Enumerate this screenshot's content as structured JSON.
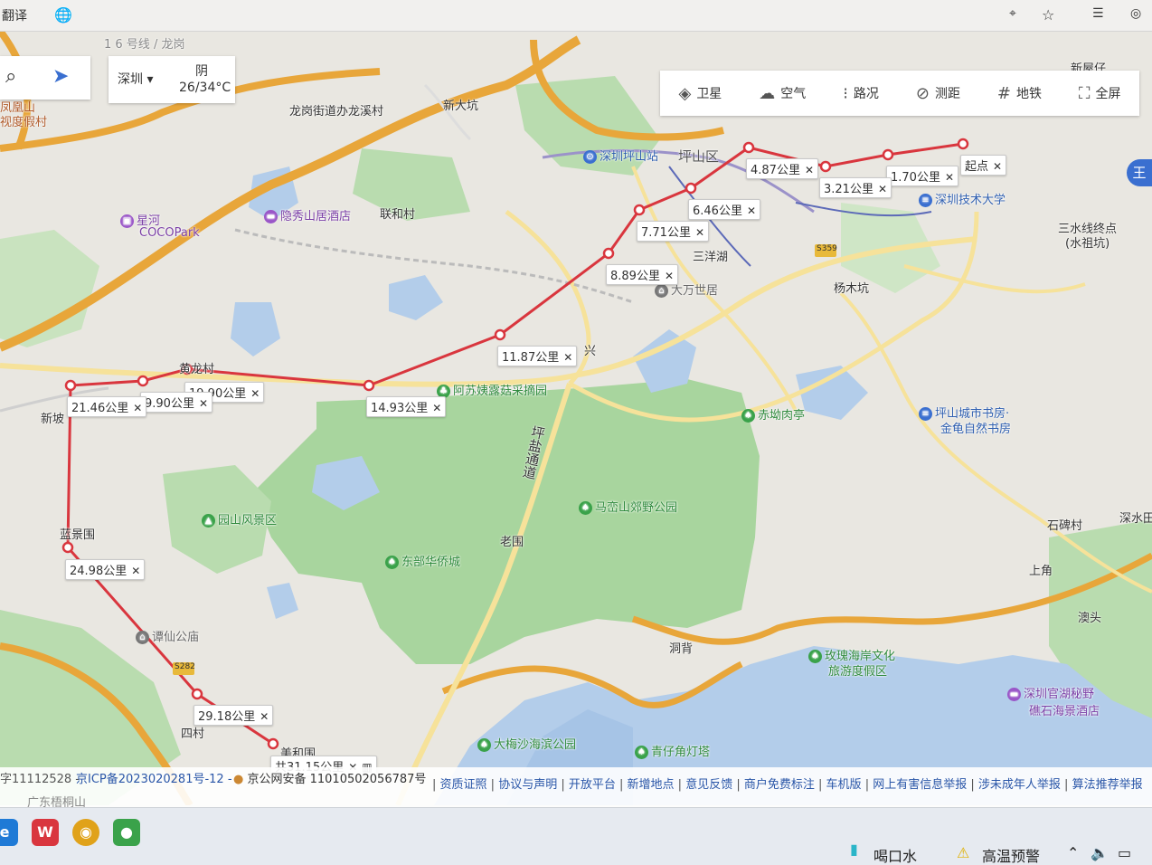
{
  "browser": {
    "translate_label": "翻译",
    "icons": [
      "globe-icon",
      "location-icon",
      "star-icon",
      "menu-icon",
      "profile-icon"
    ]
  },
  "search": {
    "icons": [
      "search-icon",
      "route-icon"
    ]
  },
  "city_panel": {
    "city": "深圳",
    "weather": "阴",
    "temp": "26/34°C"
  },
  "toolbar": {
    "items": [
      {
        "label": "卫星",
        "icon": "satellite-icon"
      },
      {
        "label": "空气",
        "icon": "air-icon"
      },
      {
        "label": "路况",
        "icon": "traffic-icon"
      },
      {
        "label": "测距",
        "icon": "ruler-icon"
      },
      {
        "label": "地铁",
        "icon": "subway-icon"
      },
      {
        "label": "全屏",
        "icon": "fullscreen-icon"
      }
    ]
  },
  "measure": {
    "start_label": "起点",
    "distances": [
      "1.70公里",
      "3.21公里",
      "4.87公里",
      "6.46公里",
      "7.71公里",
      "8.89公里",
      "11.87公里",
      "14.93公里",
      "19.90公里",
      "9.90公里",
      "21.46公里",
      "24.98公里",
      "29.18公里"
    ],
    "total": "共31.15公里",
    "line_color": "#d9363e"
  },
  "places": {
    "line6": "1 6 号线 / 龙岗",
    "longgang_street": "龙岗街道办龙溪村",
    "xindakeng": "新大坑",
    "pingshan_district": "坪山区",
    "pingshan_station": "深圳坪山站",
    "tech_univ": "深圳技术大学",
    "xinghe": "星河",
    "coco": "COCOPark",
    "yinxiu_hotel": "隐秀山居酒店",
    "lianhe": "联和村",
    "sanyanghu": "三洋湖",
    "s359": "S359",
    "dawan": "大万世居",
    "yangmukeng": "杨木坑",
    "sanshui": "三水线终点",
    "shuizu": "(水祖坑)",
    "xinxing": "兴",
    "asu_farm": "阿苏姨露菇采摘园",
    "chikan": "赤坳肉亭",
    "pingshan_bookstore": "坪山城市书房·",
    "jinjiao_bookstore": "金龟自然书房",
    "pingyan_road": "坪盐通道",
    "laowei": "老围",
    "mashan_park": "马峦山郊野公园",
    "yuanshan": "园山风景区",
    "dongbu": "东部华侨城",
    "shibeicun": "石碑村",
    "shenshuitian": "深水田",
    "shangwei": "上角",
    "aotou": "澳头",
    "dongbei": "洞背",
    "meigui_resort1": "玫瑰海岸文化",
    "meigui_resort2": "旅游度假区",
    "guanhu_hotel1": "深圳官湖秘野",
    "guanhu_hotel2": "礁石海景酒店",
    "dameisha": "大梅沙海滨公园",
    "qingzai": "青仔角灯塔",
    "tanxian_temple": "谭仙公庙",
    "s282": "S282",
    "sicun": "四村",
    "lanjingwei": "蓝景围",
    "xinpo": "新坡",
    "huanglongcun": "黄龙村",
    "meiyuan": "美和围",
    "fenghuangshan": "凤凰山",
    "shidu_resort": "视度假村",
    "guangdong": "广东梧桐山",
    "xinwu": "新屋仔"
  },
  "footer": {
    "icp": "字11112528 -",
    "icp_link": "京ICP备2023020281号-12 -",
    "police": "京公网安备 11010502056787号",
    "links": [
      "资质证照",
      "协议与声明",
      "开放平台",
      "新增地点",
      "意见反馈",
      "商户免费标注",
      "车机版",
      "网上有害信息举报",
      "涉未成年人举报",
      "算法推荐举报"
    ]
  },
  "taskbar": {
    "apps": [
      {
        "name": "edge-app",
        "label": "e",
        "color": "#1f7ad6"
      },
      {
        "name": "wps-app",
        "label": "W",
        "color": "#d9363e"
      },
      {
        "name": "chrome-app",
        "label": "◉",
        "color": "#e0a21a"
      },
      {
        "name": "wechat-app",
        "label": "●",
        "color": "#3aa24a"
      }
    ],
    "tray": [
      "喝口水",
      "高温预警"
    ]
  },
  "colors": {
    "park": "#a8d59e",
    "water": "#b3cdea",
    "highway": "#e8a63a",
    "road": "#f6e29a"
  }
}
